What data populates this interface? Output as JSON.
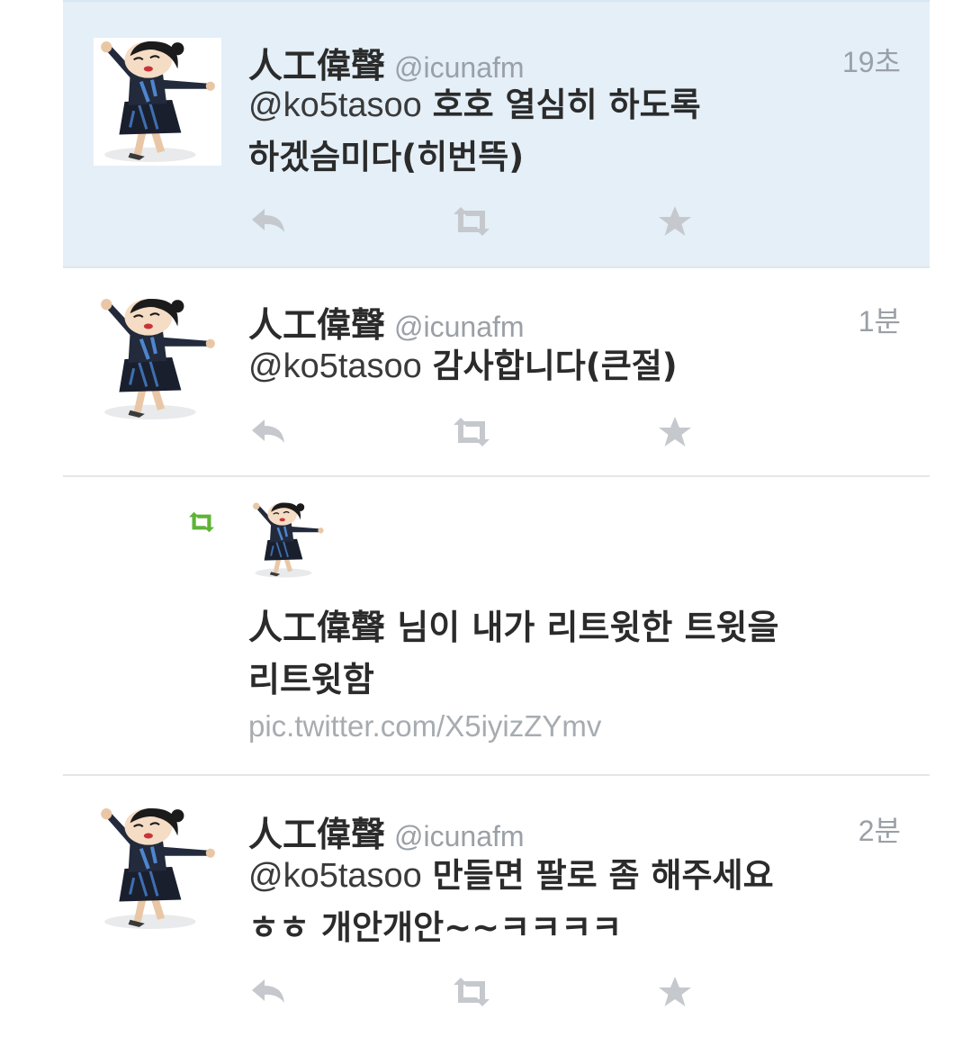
{
  "tweets": [
    {
      "name": "人工偉聲",
      "handle": "@icunafm",
      "time": "19초",
      "mention": "@ko5tasoo",
      "text_line1": "호호 열심히 하도록",
      "text_line2": "하겠슴미다(히번뜩)"
    },
    {
      "name": "人工偉聲",
      "handle": "@icunafm",
      "time": "1분",
      "mention": "@ko5tasoo",
      "text_line1": "감사합니다(큰절)"
    },
    {
      "rt_name": "人工偉聲",
      "rt_line1": "님이 내가 리트윗한 트윗을",
      "rt_line2": "리트윗함",
      "link": "pic.twitter.com/X5iyizZYmv"
    },
    {
      "name": "人工偉聲",
      "handle": "@icunafm",
      "time": "2분",
      "mention": "@ko5tasoo",
      "text_line1": "만들면 팔로 좀 해주세요",
      "text_line2": "ㅎㅎ 개안개안~~ㅋㅋㅋㅋ"
    }
  ],
  "colors": {
    "highlight": "#e4eff8",
    "retweet_green": "#5fb336",
    "action_gray": "#c5c9cd",
    "meta_gray": "#9aa0a6"
  },
  "icons": [
    "reply-icon",
    "retweet-icon",
    "favorite-star-icon",
    "avatar-figure-skater"
  ]
}
